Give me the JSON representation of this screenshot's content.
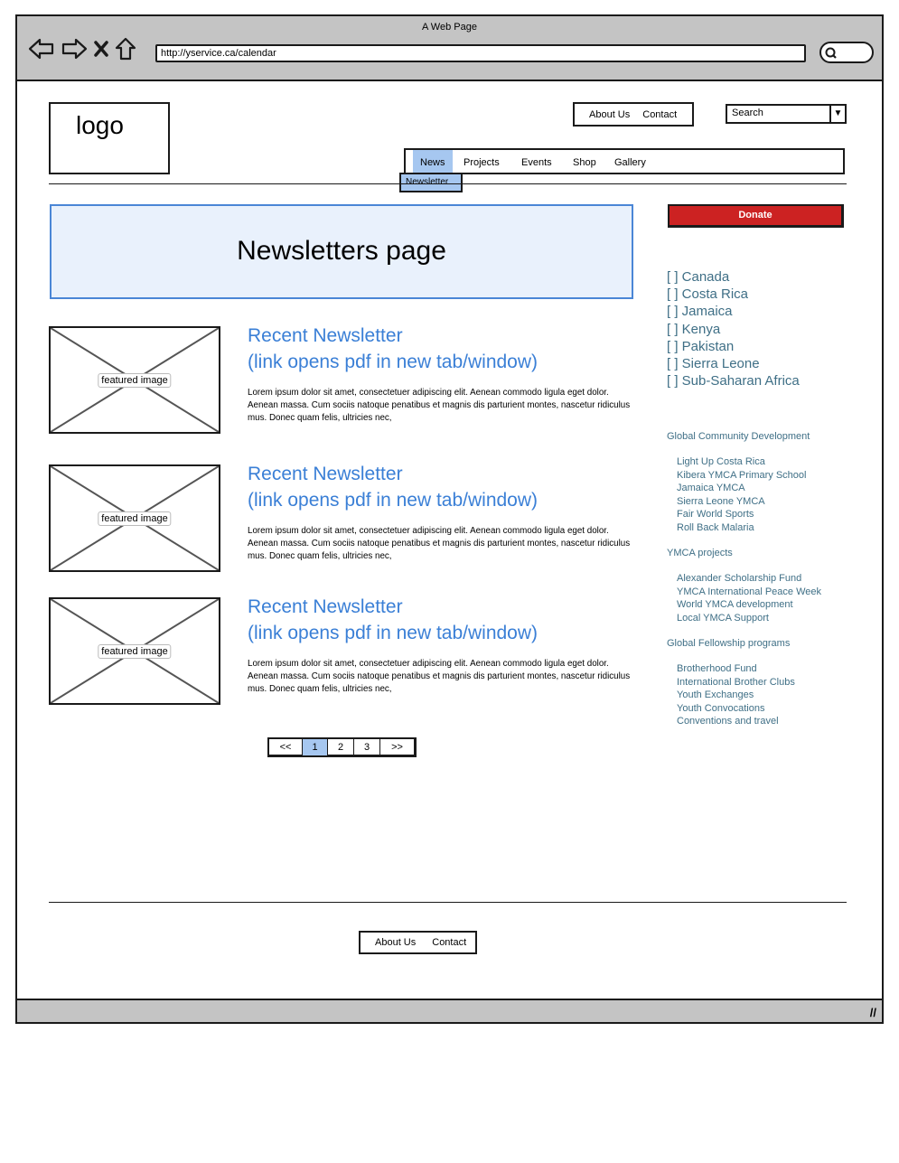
{
  "browser": {
    "title": "A Web Page",
    "url": "http://yservice.ca/calendar"
  },
  "header": {
    "logo": "logo",
    "top_links": [
      "About Us",
      "Contact"
    ],
    "search_placeholder": "Search"
  },
  "nav": {
    "items": [
      "News",
      "Projects",
      "Events",
      "Shop",
      "Gallery"
    ],
    "active": "News",
    "submenu_item": "Newsletter"
  },
  "hero": {
    "title": "Newsletters page"
  },
  "newsletters": [
    {
      "image_label": "featured image",
      "title_line1": "Recent Newsletter",
      "title_line2": "(link opens pdf in new tab/window)",
      "text": "Lorem ipsum dolor sit amet, consectetuer adipiscing elit. Aenean commodo ligula eget dolor. Aenean massa. Cum sociis natoque penatibus et magnis dis parturient montes, nascetur ridiculus mus. Donec quam felis, ultricies nec,"
    },
    {
      "image_label": "featured image",
      "title_line1": "Recent Newsletter",
      "title_line2": "(link opens pdf in new tab/window)",
      "text": "Lorem ipsum dolor sit amet, consectetuer adipiscing elit. Aenean commodo ligula eget dolor. Aenean massa. Cum sociis natoque penatibus et magnis dis parturient montes, nascetur ridiculus mus. Donec quam felis, ultricies nec,"
    },
    {
      "image_label": "featured image",
      "title_line1": "Recent Newsletter",
      "title_line2": "(link opens pdf in new tab/window)",
      "text": "Lorem ipsum dolor sit amet, consectetuer adipiscing elit. Aenean commodo ligula eget dolor. Aenean massa. Cum sociis natoque penatibus et magnis dis parturient montes, nascetur ridiculus mus. Donec quam felis, ultricies nec,"
    }
  ],
  "pagination": {
    "prev": "<<",
    "pages": [
      "1",
      "2",
      "3"
    ],
    "current": "1",
    "next": ">>"
  },
  "sidebar": {
    "donate": "Donate",
    "countries": [
      "[ ] Canada",
      "[ ] Costa Rica",
      "[ ] Jamaica",
      "[ ] Kenya",
      "[ ] Pakistan",
      "[ ] Sierra Leone",
      "[ ] Sub-Saharan Africa"
    ],
    "groups": [
      {
        "heading": "Global Community Development",
        "items": [
          "Light Up Costa Rica",
          "Kibera YMCA Primary School",
          "Jamaica  YMCA",
          "Sierra Leone YMCA",
          "Fair World Sports",
          "Roll Back Malaria"
        ]
      },
      {
        "heading": "YMCA projects",
        "items": [
          "Alexander Scholarship Fund",
          "YMCA International Peace Week",
          "World YMCA development",
          "Local YMCA Support"
        ]
      },
      {
        "heading": "Global Fellowship programs",
        "items": [
          "Brotherhood Fund",
          "International Brother Clubs",
          "Youth Exchanges",
          "Youth Convocations",
          "Conventions and travel"
        ]
      }
    ]
  },
  "footer": {
    "links": [
      "About Us",
      "Contact"
    ]
  },
  "colors": {
    "accent": "#3a7fd6",
    "donate": "#cc2222",
    "sidebar_text": "#3f6f86",
    "active_nav": "#a6c7f0"
  }
}
